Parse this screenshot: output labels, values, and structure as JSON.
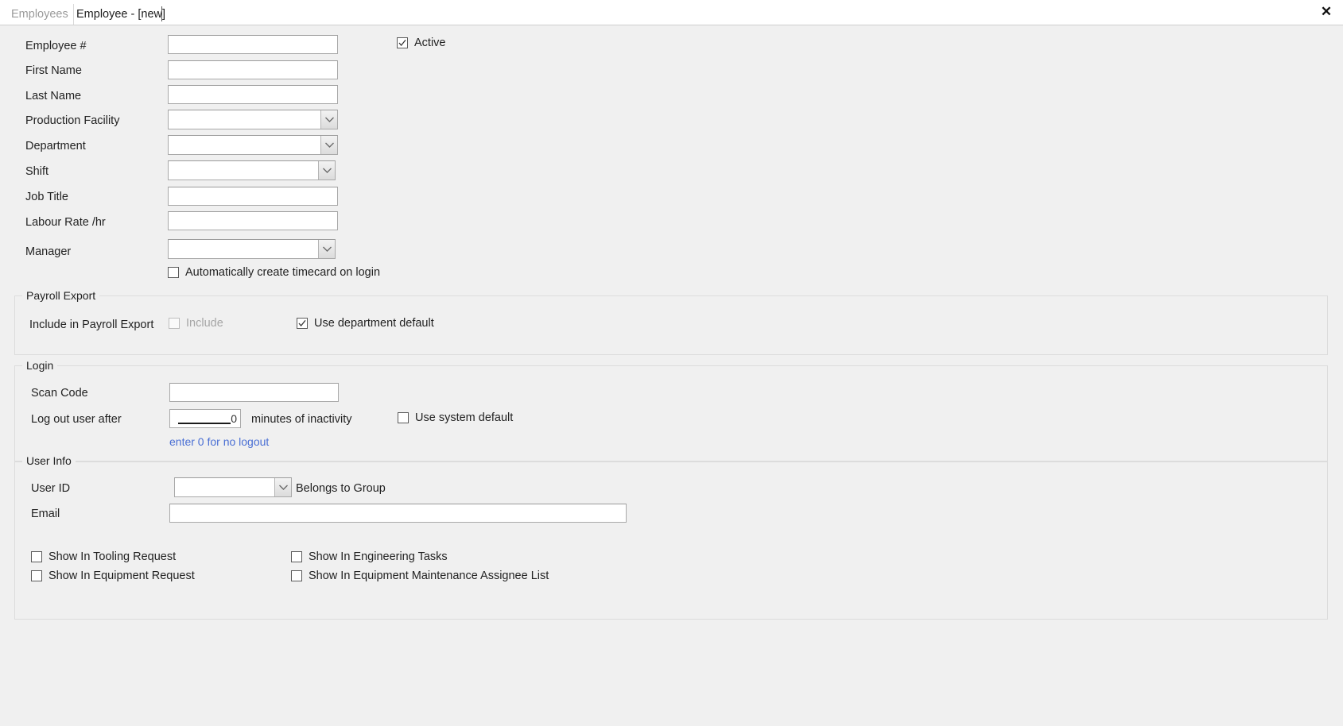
{
  "window": {
    "close_label": "✕"
  },
  "tabs": [
    {
      "label": "Employees",
      "active": false
    },
    {
      "label": "Employee - [new]",
      "active": true
    }
  ],
  "fields": {
    "employee_number": {
      "label": "Employee #",
      "value": "",
      "placeholder": ""
    },
    "first_name": {
      "label": "First Name",
      "value": "",
      "placeholder": ""
    },
    "last_name": {
      "label": "Last Name",
      "value": "",
      "placeholder": ""
    },
    "production_facility": {
      "label": "Production Facility",
      "value": ""
    },
    "department": {
      "label": "Department",
      "value": ""
    },
    "shift": {
      "label": "Shift",
      "value": ""
    },
    "job_title": {
      "label": "Job Title",
      "value": "",
      "placeholder": ""
    },
    "labour_rate": {
      "label": "Labour Rate /hr",
      "value": "",
      "placeholder": ""
    },
    "manager": {
      "label": "Manager",
      "value": ""
    }
  },
  "active_checkbox": {
    "label": "Active",
    "checked": true
  },
  "auto_timecard_checkbox": {
    "label": "Automatically create timecard on login",
    "checked": false
  },
  "payroll_export": {
    "caption": "Payroll Export",
    "row_label": "Include in Payroll Export",
    "include": {
      "label": "Include",
      "checked": false,
      "disabled": true
    },
    "use_department_default": {
      "label": "Use department  default",
      "checked": true
    }
  },
  "login": {
    "caption": "Login",
    "scan_code": {
      "label": "Scan Code",
      "value": "",
      "placeholder": ""
    },
    "logout_after": {
      "label": "Log out user after",
      "value": "0",
      "suffix": "minutes of inactivity",
      "hint": "enter 0 for no logout"
    },
    "use_system_default": {
      "label": "Use system default",
      "checked": false
    }
  },
  "user_info": {
    "caption": "User Info",
    "user_id": {
      "label": "User ID",
      "value": ""
    },
    "belongs_to_group": "Belongs to Group",
    "email": {
      "label": "Email",
      "value": "",
      "placeholder": ""
    },
    "options": [
      {
        "label": "Show In Tooling Request",
        "checked": false
      },
      {
        "label": "Show In Engineering Tasks",
        "checked": false
      },
      {
        "label": "Show In Equipment Request",
        "checked": false
      },
      {
        "label": "Show In Equipment Maintenance Assignee List",
        "checked": false
      }
    ]
  },
  "colors": {
    "background": "#f0f0f0",
    "tab_active_text": "#1d1d1d",
    "tab_inactive_text": "#9a9a9a",
    "link": "#4a6fd4",
    "disabled_text": "#a6a6a6",
    "field_border": "#a9a9a9",
    "group_border": "#dcdcdc"
  }
}
